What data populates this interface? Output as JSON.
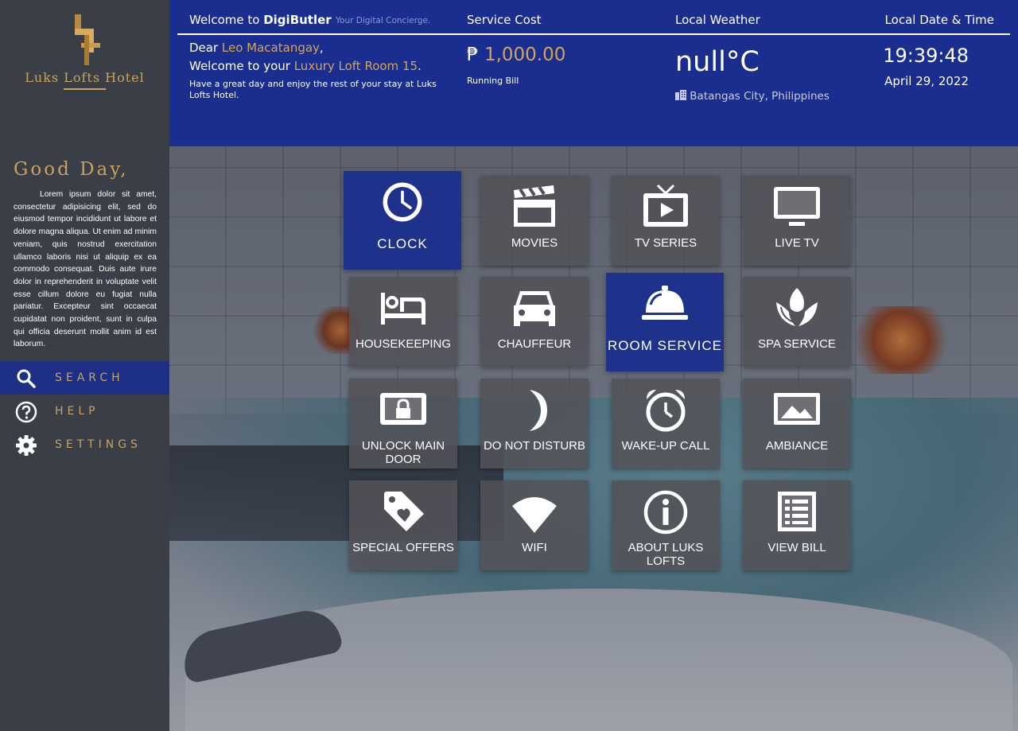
{
  "brand": {
    "name": "Luks Lofts Hotel"
  },
  "sidebar": {
    "greeting": "Good Day,",
    "body": "Lorem ipsum dolor sit amet, consectetur adipisicing elit, sed do eiusmod tempor incididunt ut labore et dolore magna aliqua. Ut enim ad minim veniam, quis nostrud exercitation ullamco laboris nisi ut aliquip ex ea commodo consequat. Duis aute irure dolor in reprehenderit in voluptate velit esse cillum dolore eu fugiat nulla pariatur. Excepteur sint occaecat cupidatat non proident, sunt in culpa qui officia deserunt mollit anim id est laborum.",
    "nav": [
      {
        "label": "SEARCH",
        "icon": "search-icon",
        "active": true
      },
      {
        "label": "HELP",
        "icon": "help-icon",
        "active": false
      },
      {
        "label": "SETTINGS",
        "icon": "gear-icon",
        "active": false
      }
    ]
  },
  "header": {
    "welcome_prefix": "Welcome to ",
    "app_name": "DigiButler",
    "tagline": "Your Digital Concierge.",
    "service_cost_title": "Service Cost",
    "weather_title": "Local Weather",
    "datetime_title": "Local Date & Time",
    "dear_prefix": "Dear ",
    "guest_name": "Leo Macatangay",
    "dear_suffix": ",",
    "welcome_room_prefix": "Welcome to your ",
    "room_name": "Luxury Loft Room 15",
    "welcome_room_suffix": ".",
    "enjoy": "Have a great day and enjoy the rest of your stay at Luks Lofts Hotel.",
    "currency_symbol": "₱",
    "cost_value": "1,000.00",
    "running_bill": "Running Bill",
    "temperature": "null°C",
    "city": "Batangas City, Philippines",
    "time": "19:39:48",
    "date": "April 29, 2022"
  },
  "tiles": [
    {
      "label": "CLOCK",
      "icon": "clock-icon",
      "active": true
    },
    {
      "label": "MOVIES",
      "icon": "clapperboard-icon"
    },
    {
      "label": "TV SERIES",
      "icon": "tv-play-icon"
    },
    {
      "label": "LIVE TV",
      "icon": "monitor-icon"
    },
    {
      "label": "HOUSEKEEPING",
      "icon": "bed-icon"
    },
    {
      "label": "CHAUFFEUR",
      "icon": "car-icon"
    },
    {
      "label": "ROOM SERVICE",
      "icon": "cloche-icon",
      "active": true
    },
    {
      "label": "SPA SERVICE",
      "icon": "lotus-icon"
    },
    {
      "label": "UNLOCK MAIN DOOR",
      "icon": "lock-icon"
    },
    {
      "label": "DO NOT DISTURB",
      "icon": "moon-icon"
    },
    {
      "label": "WAKE-UP CALL",
      "icon": "alarm-icon"
    },
    {
      "label": "AMBIANCE",
      "icon": "image-icon"
    },
    {
      "label": "SPECIAL OFFERS",
      "icon": "tag-heart-icon"
    },
    {
      "label": "WIFI",
      "icon": "wifi-icon"
    },
    {
      "label": "ABOUT LUKS LOFTS",
      "icon": "info-icon"
    },
    {
      "label": "VIEW BILL",
      "icon": "list-icon"
    }
  ],
  "colors": {
    "accent_gold": "#c9a25e",
    "header_blue": "#162b91",
    "active_tile": "#1e328c",
    "sidebar": "#3a3e47"
  }
}
